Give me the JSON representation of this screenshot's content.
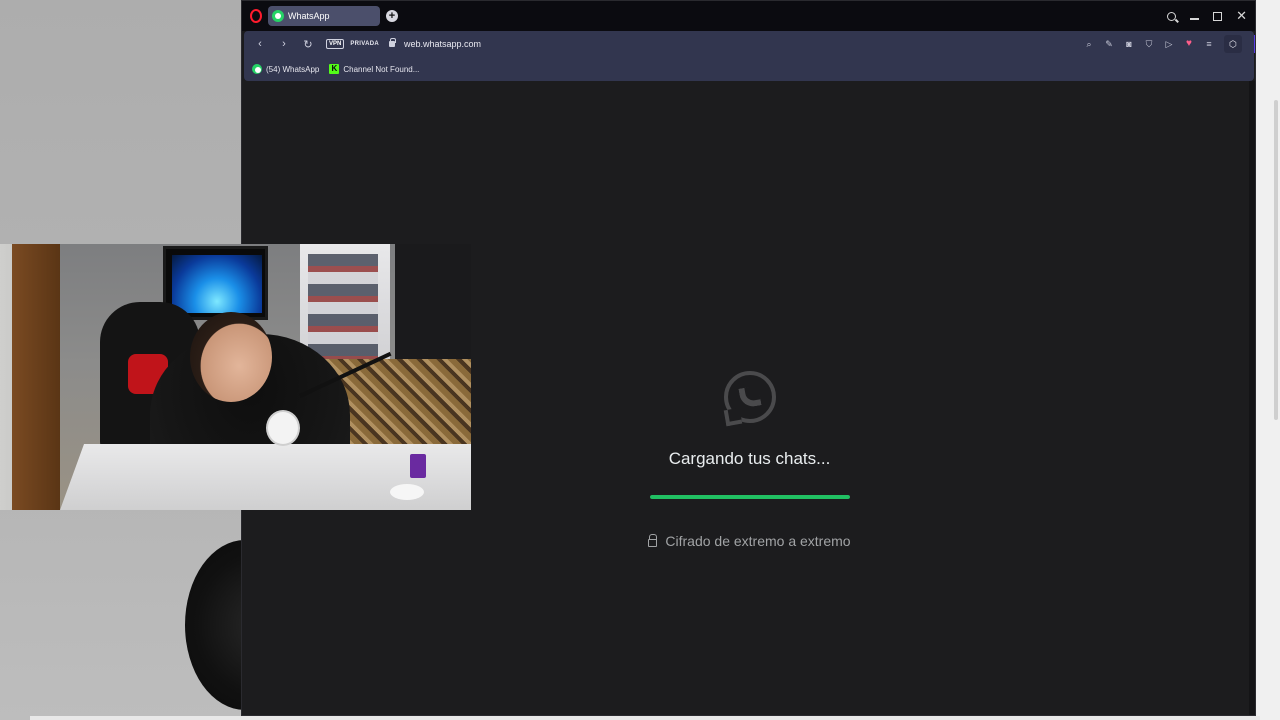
{
  "browser": {
    "tab": {
      "label": "WhatsApp"
    },
    "address": {
      "vpn_label": "VPN",
      "privacy_label": "PRIVADA",
      "url": "web.whatsapp.com"
    },
    "bookmarks": [
      {
        "label": "(54) WhatsApp",
        "icon": "whatsapp-icon"
      },
      {
        "label": "Channel Not Found...",
        "icon": "kick-icon"
      }
    ]
  },
  "loader": {
    "title": "Cargando tus chats...",
    "progress": 1.0,
    "encryption_text": "Cifrado de extremo a extremo"
  },
  "colors": {
    "progress_green": "#21c063",
    "page_bg": "#1c1c1e",
    "opera_red": "#ff1b2d",
    "tab_bg": "#4b4f6b"
  }
}
